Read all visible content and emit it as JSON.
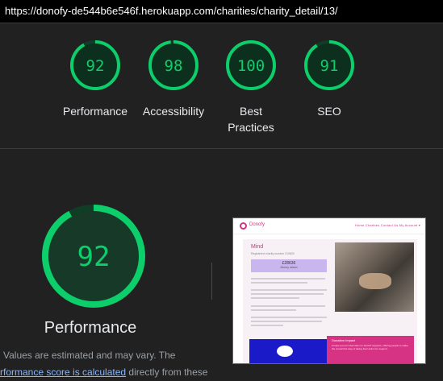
{
  "url": "https://donofy-de544b6e546f.herokuapp.com/charities/charity_detail/13/",
  "colors": {
    "pass_ring": "#0cce6b",
    "pass_text": "#0cce6b",
    "ring_track": "#0f3d25"
  },
  "summary": {
    "gauges": [
      {
        "score": 92,
        "label": "Performance"
      },
      {
        "score": 98,
        "label": "Accessibility"
      },
      {
        "score": 100,
        "label": "Best Practices",
        "label_line1": "Best",
        "label_line2": "Practices"
      },
      {
        "score": 91,
        "label": "SEO"
      }
    ]
  },
  "detail": {
    "score": 92,
    "title": "Performance",
    "note_line1": "Values are estimated and may vary. The",
    "note_link": "rformance score is calculated",
    "note_rest": " directly from these"
  },
  "thumbnail": {
    "brand": "Donofy",
    "nav_links": "Home   Charities   Contact Us   My Account ▾",
    "charity_title": "Mind",
    "charity_sub": "Registered charity number 219830",
    "raised_amount": "£28636",
    "raised_label": "Money raised",
    "pink_heading": "Donation Impact",
    "pink_text": "£ helps put our information to hard IP supports, offering people to make the crucial first step of taking their action for support."
  }
}
